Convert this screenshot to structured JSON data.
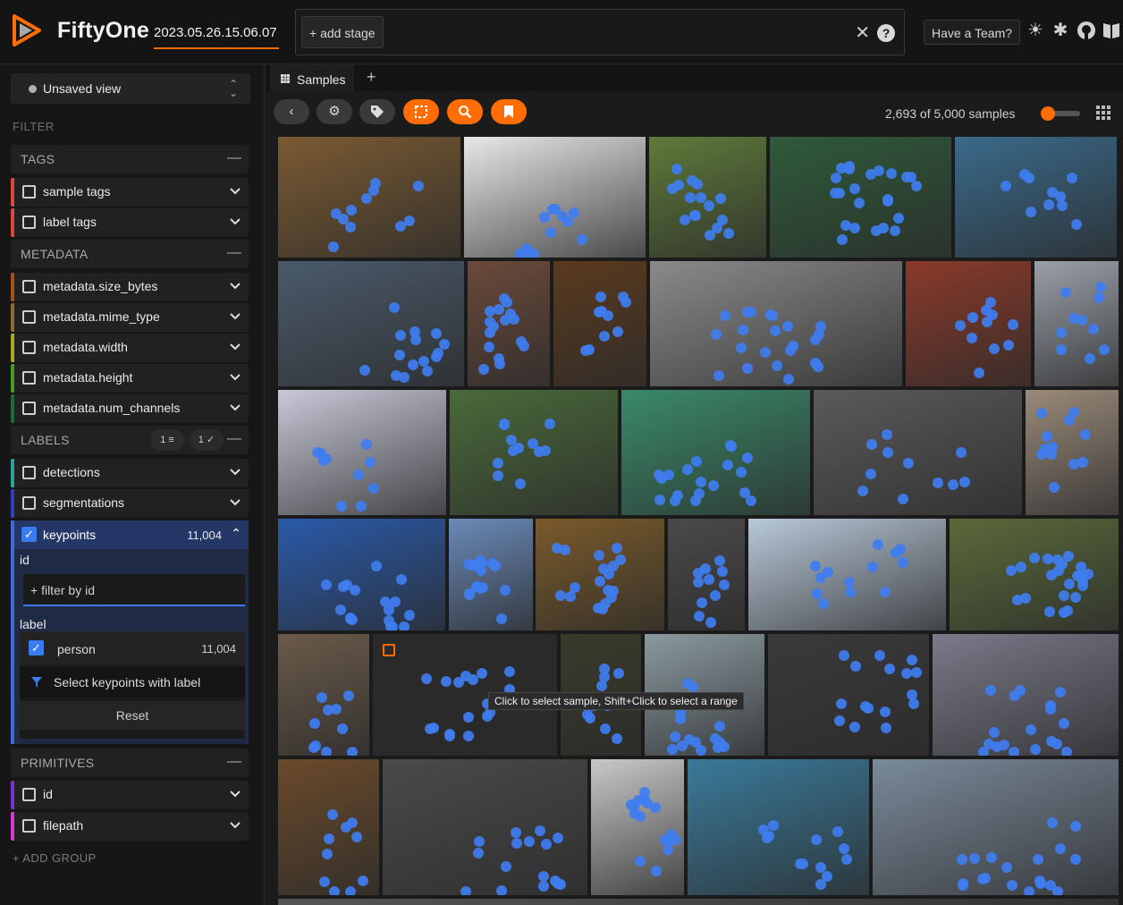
{
  "header": {
    "app_title": "FiftyOne",
    "dataset_name": "2023.05.26.15.06.07",
    "add_stage_label": "+ add stage",
    "team_button": "Have a Team?"
  },
  "sidebar": {
    "view_select": "Unsaved view",
    "filter_title": "FILTER",
    "groups": {
      "tags": "TAGS",
      "metadata": "METADATA",
      "labels": "LABELS",
      "primitives": "PRIMITIVES"
    },
    "tag_fields": [
      "sample tags",
      "label tags"
    ],
    "metadata_fields": [
      "metadata.size_bytes",
      "metadata.mime_type",
      "metadata.width",
      "metadata.height",
      "metadata.num_channels"
    ],
    "labels_badges": [
      "1",
      "1"
    ],
    "label_fields": [
      "detections",
      "segmentations"
    ],
    "keypoints": {
      "label": "keypoints",
      "count": "11,004",
      "id_label": "id",
      "filter_placeholder": "+ filter by id",
      "label_label": "label",
      "person_label": "person",
      "person_count": "11,004",
      "select_keypoints": "Select keypoints with label",
      "reset": "Reset"
    },
    "primitive_fields": [
      "id",
      "filepath"
    ],
    "add_group": "+ ADD GROUP",
    "field_colors": {
      "tags": "#d9483b",
      "size_bytes": "#a3521b",
      "mime_type": "#8f6a2a",
      "width": "#a8a82a",
      "height": "#4a9a2a",
      "num_channels": "#1e6b3a",
      "detections": "#2aa39a",
      "segmentations": "#2f3fbf",
      "keypoints": "#3f6bd6",
      "id": "#7a2fd0",
      "filepath": "#d23fd0"
    }
  },
  "main": {
    "tab_label": "Samples",
    "sample_count": "2,693 of 5,000 samples",
    "tooltip": "Click to select sample, Shift+Click to select a range",
    "accent": "#ff6d04",
    "keypoint_color": "#3f7df0"
  }
}
